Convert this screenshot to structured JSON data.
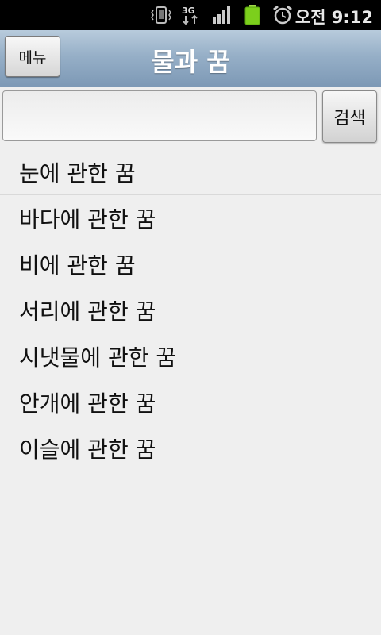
{
  "status_bar": {
    "time": "오전 9:12",
    "icons": [
      "vibrate-icon",
      "3g-data-icon",
      "signal-icon",
      "battery-icon",
      "alarm-icon"
    ],
    "network_label": "3G"
  },
  "header": {
    "menu_label": "메뉴",
    "title": "물과 꿈"
  },
  "search": {
    "value": "",
    "placeholder": "",
    "button_label": "검색"
  },
  "list": {
    "items": [
      {
        "label": "눈에 관한 꿈"
      },
      {
        "label": "바다에 관한 꿈"
      },
      {
        "label": "비에 관한 꿈"
      },
      {
        "label": "서리에 관한 꿈"
      },
      {
        "label": "시냇물에 관한 꿈"
      },
      {
        "label": "안개에 관한 꿈"
      },
      {
        "label": "이슬에 관한 꿈"
      }
    ]
  },
  "colors": {
    "title_bar_top": "#b8cbdc",
    "title_bar_bottom": "#7c98b5",
    "background": "#efefef",
    "battery": "#7ccf1c"
  }
}
